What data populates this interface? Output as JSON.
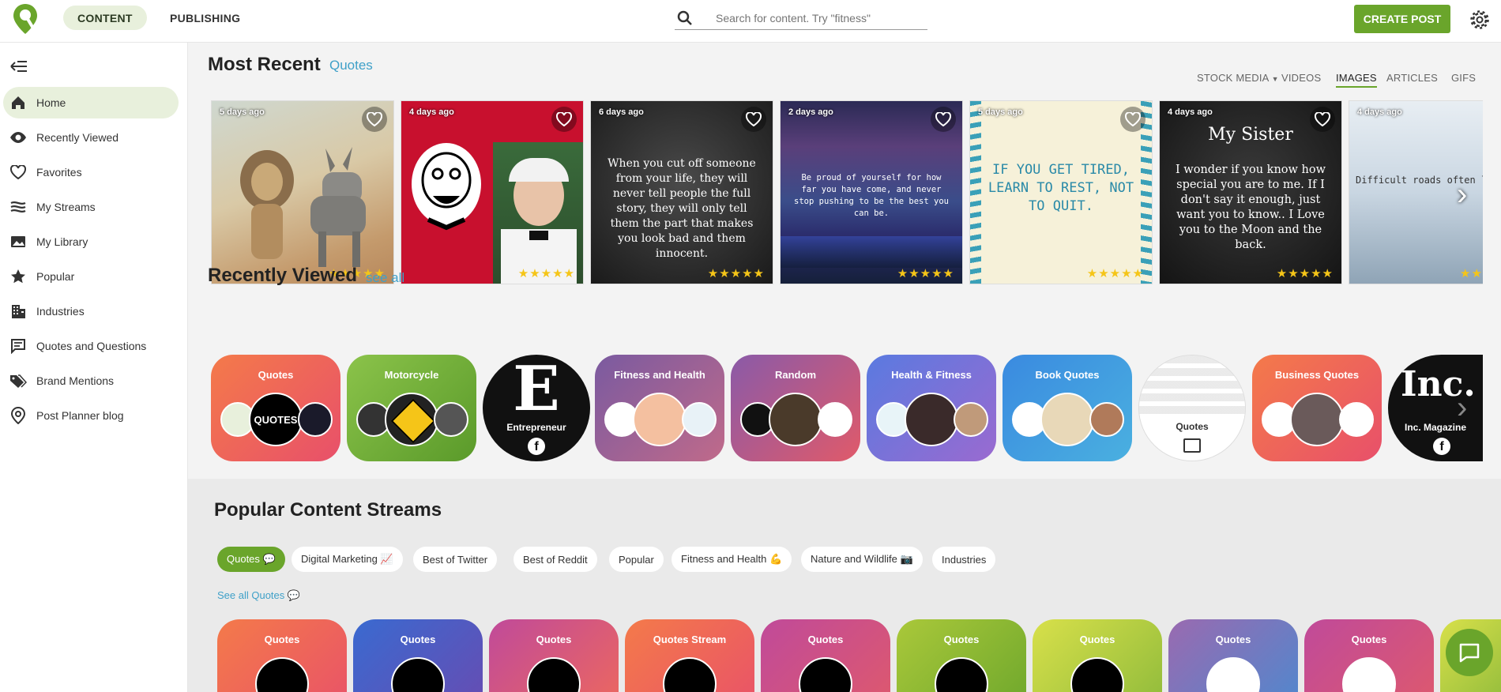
{
  "topbar": {
    "tabs": [
      "CONTENT",
      "PUBLISHING"
    ],
    "search_placeholder": "Search for content. Try \"fitness\"",
    "create_label": "CREATE POST"
  },
  "sidebar": {
    "items": [
      {
        "label": "Home",
        "icon": "home-icon"
      },
      {
        "label": "Recently Viewed",
        "icon": "eye-icon"
      },
      {
        "label": "Favorites",
        "icon": "heart-icon"
      },
      {
        "label": "My Streams",
        "icon": "streams-icon"
      },
      {
        "label": "My Library",
        "icon": "library-icon"
      },
      {
        "label": "Popular",
        "icon": "star-icon"
      },
      {
        "label": "Industries",
        "icon": "building-icon"
      },
      {
        "label": "Quotes and Questions",
        "icon": "chat-icon"
      },
      {
        "label": "Brand Mentions",
        "icon": "tag-icon"
      },
      {
        "label": "Post Planner blog",
        "icon": "pin-icon"
      }
    ]
  },
  "most_recent": {
    "title": "Most Recent",
    "subtitle": "Quotes",
    "media_tabs": [
      "STOCK MEDIA",
      "VIDEOS",
      "IMAGES",
      "ARTICLES",
      "GIFS"
    ],
    "active_tab": "IMAGES",
    "cards": [
      {
        "age": "5 days ago",
        "text": "",
        "stars": "★★★★★"
      },
      {
        "age": "4 days ago",
        "text": "",
        "stars": "★★★★★"
      },
      {
        "age": "6 days ago",
        "text": "When you cut off someone from your life, they will never tell people the full story, they will only tell them the part that makes you look bad and them innocent.",
        "stars": "★★★★★"
      },
      {
        "age": "2 days ago",
        "text": "Be proud of yourself for how far you have come, and never stop pushing to be the best you can be.",
        "stars": "★★★★★"
      },
      {
        "age": "5 days ago",
        "text": "IF YOU GET TIRED, LEARN TO REST, NOT TO QUIT.",
        "stars": "★★★★★"
      },
      {
        "age": "4 days ago",
        "heading": "My Sister",
        "text": "I wonder if you know how special you are to me. If I don't say it enough, just want you to know..  I Love you to the Moon and the back.",
        "stars": "★★★★★"
      },
      {
        "age": "4 days ago",
        "text": "Difficult roads often lead to beautiful destinations",
        "stars": "★★"
      }
    ]
  },
  "recently_viewed": {
    "title": "Recently Viewed",
    "link": "see all",
    "streams": [
      {
        "name": "Quotes"
      },
      {
        "name": "Motorcycle"
      },
      {
        "name": "Entrepreneur"
      },
      {
        "name": "Fitness and Health"
      },
      {
        "name": "Random"
      },
      {
        "name": "Health & Fitness"
      },
      {
        "name": "Book Quotes"
      },
      {
        "name": "Quotes"
      },
      {
        "name": "Business Quotes"
      },
      {
        "name": "Inc. Magazine"
      }
    ]
  },
  "popular": {
    "title": "Popular Content Streams",
    "pills": [
      "Quotes 💬",
      "Digital Marketing 📈",
      "Best of Twitter",
      "Best of Reddit",
      "Popular",
      "Fitness and Health 💪",
      "Nature and Wildlife 📷",
      "Industries"
    ],
    "see_all": "See all Quotes 💬",
    "streams": [
      "Quotes",
      "Quotes",
      "Quotes",
      "Quotes Stream",
      "Quotes",
      "Quotes",
      "Quotes",
      "Quotes",
      "Quotes"
    ]
  },
  "colors": {
    "brand_green": "#6aa52b",
    "link_blue": "#3fa0c8",
    "active_bg": "#e8f0dc"
  }
}
